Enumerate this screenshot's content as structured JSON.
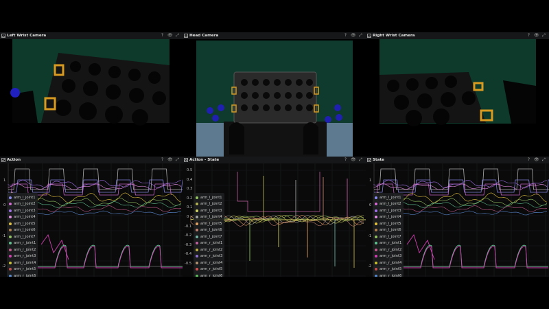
{
  "panels": {
    "left_wrist": {
      "title": "Left Wrist Camera"
    },
    "head": {
      "title": "Head Camera"
    },
    "right_wrist": {
      "title": "Right Wrist Camera"
    },
    "action": {
      "title": "Action"
    },
    "action_state": {
      "title": "Action - State"
    },
    "state": {
      "title": "State"
    }
  },
  "toolbar": {
    "help": "?",
    "visibility": "👁",
    "expand": "⤢"
  },
  "legend_items": [
    {
      "label": "arm_l_joint1",
      "color": "#8c8cf0"
    },
    {
      "label": "arm_l_joint2",
      "color": "#d46ad4"
    },
    {
      "label": "arm_l_joint3",
      "color": "#a070e8"
    },
    {
      "label": "arm_l_joint4",
      "color": "#e08ae0"
    },
    {
      "label": "arm_l_joint5",
      "color": "#e0c040"
    },
    {
      "label": "arm_l_joint6",
      "color": "#b08050"
    },
    {
      "label": "arm_l_joint7",
      "color": "#90c060"
    },
    {
      "label": "arm_r_joint1",
      "color": "#60c090"
    },
    {
      "label": "arm_r_joint2",
      "color": "#c05a8a"
    },
    {
      "label": "arm_r_joint3",
      "color": "#d040b0"
    },
    {
      "label": "arm_r_joint4",
      "color": "#c8c030"
    },
    {
      "label": "arm_r_joint5",
      "color": "#c05050"
    },
    {
      "label": "arm_r_joint6",
      "color": "#5a8ad0"
    }
  ],
  "legend_action_state": [
    {
      "label": "arm_l_joint1",
      "color": "#90c060"
    },
    {
      "label": "arm_l_joint2",
      "color": "#b0b050"
    },
    {
      "label": "arm_l_joint3",
      "color": "#d0d060"
    },
    {
      "label": "arm_l_joint4",
      "color": "#a0a0a0"
    },
    {
      "label": "arm_l_joint5",
      "color": "#e0a060"
    },
    {
      "label": "arm_l_joint6",
      "color": "#c08070"
    },
    {
      "label": "arm_l_joint7",
      "color": "#70b0a0"
    },
    {
      "label": "arm_r_joint1",
      "color": "#c060a0"
    },
    {
      "label": "arm_r_joint2",
      "color": "#c0b040"
    },
    {
      "label": "arm_r_joint3",
      "color": "#9070d0"
    },
    {
      "label": "arm_r_joint4",
      "color": "#b09070"
    },
    {
      "label": "arm_r_joint5",
      "color": "#d05050"
    },
    {
      "label": "arm_r_joint6",
      "color": "#60c060"
    }
  ],
  "yticks_action": [
    "1",
    "0",
    "-1",
    "-2"
  ],
  "yticks_state": [
    "1",
    "0",
    "-1",
    "-2"
  ],
  "yticks_diff": [
    "0.5",
    "0.4",
    "0.3",
    "0.2",
    "0.1",
    "0",
    "-0.1",
    "-0.2",
    "-0.3",
    "-0.4",
    "-0.5"
  ]
}
